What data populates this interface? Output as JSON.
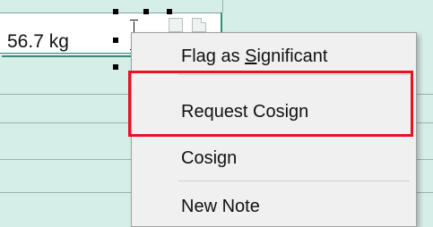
{
  "cell": {
    "value": "56.7 kg"
  },
  "context_menu": {
    "items": [
      {
        "label": "Flag as Significant",
        "underline_char": "S"
      },
      {
        "label": "Request Cosign"
      },
      {
        "label": "Cosign"
      },
      {
        "label": "New Note"
      }
    ],
    "highlighted_item": "Request Cosign",
    "highlight_color": "#e8131f"
  },
  "colors": {
    "grid_background": "#d6eee8",
    "menu_background": "#f0f0f0"
  },
  "icons": [
    "text-cursor-icon",
    "comment-icon",
    "document-icon"
  ]
}
